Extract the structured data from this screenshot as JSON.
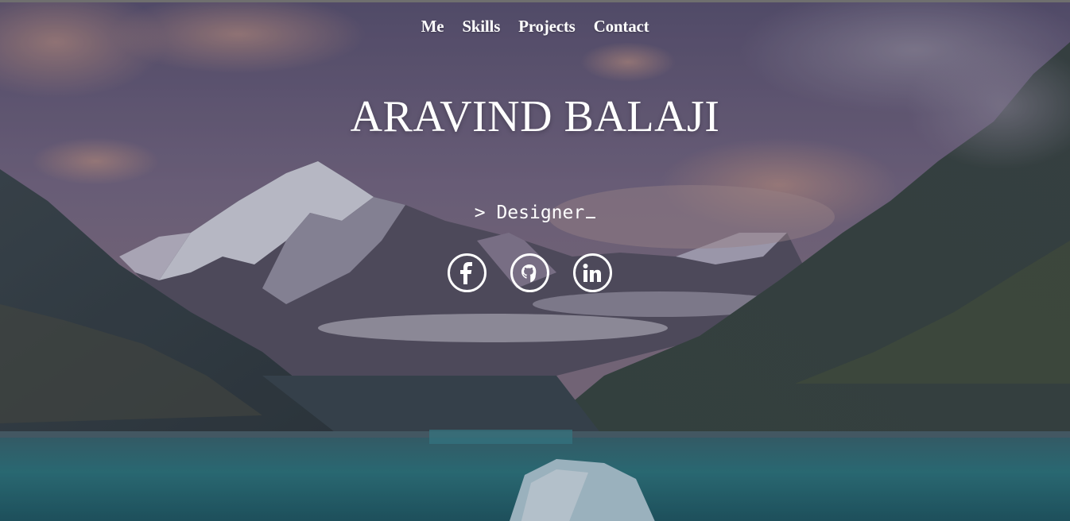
{
  "nav": {
    "items": [
      {
        "label": "Me"
      },
      {
        "label": "Skills"
      },
      {
        "label": "Projects"
      },
      {
        "label": "Contact"
      }
    ]
  },
  "hero": {
    "name": "ARAVIND BALAJI",
    "typed_text": "> Designer"
  },
  "social": {
    "icons": [
      "facebook-icon",
      "github-icon",
      "linkedin-icon"
    ]
  },
  "colors": {
    "text": "#ffffff",
    "sky_top": "#6a6080",
    "water": "#2b6f78"
  }
}
